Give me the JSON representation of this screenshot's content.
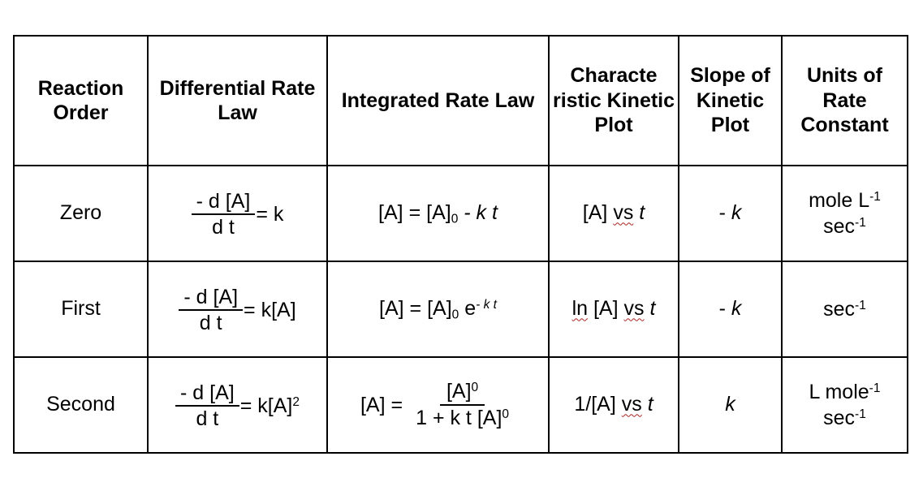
{
  "table": {
    "headers": [
      {
        "id": "reaction-order",
        "label": "Reaction Order"
      },
      {
        "id": "differential-rate-law",
        "label": "Differential Rate Law"
      },
      {
        "id": "integrated-rate-law",
        "label": "Integrated Rate Law"
      },
      {
        "id": "characteristic-kinetic-plot",
        "label": "Characte ristic Kinetic Plot"
      },
      {
        "id": "slope-of-kinetic-plot",
        "label": "Slope of Kinetic Plot"
      },
      {
        "id": "units-of-rate-constant",
        "label": "Units of Rate Constant"
      }
    ],
    "rows": [
      {
        "order": "Zero",
        "differential": {
          "numerator": "- d [A]",
          "denominator": "d t",
          "rhs_equals": "=",
          "rhs_value": "k",
          "plain": "- d[A] / d t = k"
        },
        "integrated": {
          "lhs": "[A]",
          "equals": "=",
          "rhs_base": "[A]",
          "rhs_subscript": "0",
          "rhs_tail": "- k t",
          "plain": "[A] = [A]0 - k t"
        },
        "plot": {
          "prefix": "[A]",
          "vs": "vs",
          "variable": "t",
          "plain": "[A] vs t",
          "misspelled": "vs"
        },
        "slope": {
          "text": "- k",
          "sign": "-",
          "symbol": "k"
        },
        "units": {
          "line1_text": "mole L",
          "line1_exponent": "-1",
          "line2_text": "sec",
          "line2_exponent": "-1",
          "plain": "mole L-1 sec-1"
        }
      },
      {
        "order": "First",
        "differential": {
          "numerator": "- d [A]",
          "denominator": "d t",
          "rhs_equals": "=",
          "rhs_value": "k[A]",
          "plain": "- d[A] / d t = k[A]"
        },
        "integrated": {
          "lhs": "[A]",
          "equals": "=",
          "rhs_base": "[A]",
          "rhs_subscript": "0",
          "rhs_exp_base": "e",
          "rhs_exponent": "- k t",
          "plain": "[A] = [A]0 e^(- k t)"
        },
        "plot": {
          "prefix": "ln [A]",
          "ln": "ln",
          "bracket": "[A]",
          "vs": "vs",
          "variable": "t",
          "plain": "ln [A] vs t",
          "misspelled": "ln, vs"
        },
        "slope": {
          "text": "- k",
          "sign": "-",
          "symbol": "k"
        },
        "units": {
          "line1_text": "sec",
          "line1_exponent": "-1",
          "line2_text": "",
          "line2_exponent": "",
          "plain": "sec-1"
        }
      },
      {
        "order": "Second",
        "differential": {
          "numerator": "- d [A]",
          "denominator": "d t",
          "rhs_equals": "=",
          "rhs_value": "k[A]",
          "rhs_exponent": "2",
          "plain": "- d[A] / d t = k[A]^2"
        },
        "integrated": {
          "lhs": "[A]",
          "equals": "=",
          "frac_numerator": "[A]",
          "frac_numerator_exponent": "0",
          "frac_denominator": "1 + k t [A]",
          "frac_denominator_exponent": "0",
          "plain": "[A] = [A]^0 / (1 + k t [A]^0)"
        },
        "plot": {
          "prefix": "1/[A]",
          "vs": "vs",
          "variable": "t",
          "plain": "1/[A] vs t",
          "misspelled": "vs"
        },
        "slope": {
          "text": "k",
          "sign": "",
          "symbol": "k"
        },
        "units": {
          "line1_text": "L mole",
          "line1_exponent": "-1",
          "line2_text": "sec",
          "line2_exponent": "-1",
          "plain": "L mole-1 sec-1"
        }
      }
    ]
  },
  "colors": {
    "border": "#000000",
    "text": "#000000",
    "background": "#ffffff",
    "spellcheck_underline": "#aa2222"
  }
}
